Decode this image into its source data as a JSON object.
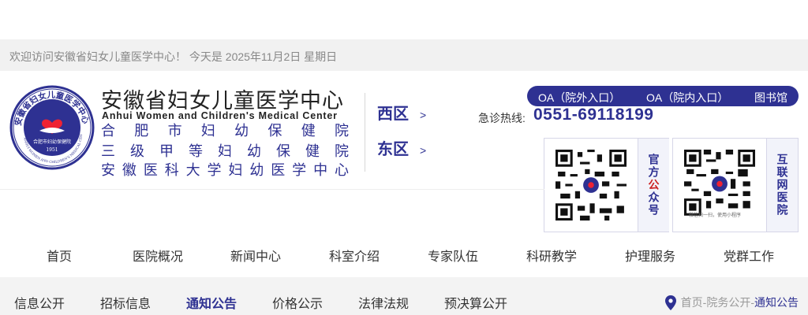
{
  "topbar": {
    "welcome": "欢迎访问安徽省妇女儿童医学中心！   今天是 2025年11月2日  星期日"
  },
  "brand": {
    "logo_ring_text": "安徽省妇女儿童医学中心",
    "logo_ring_text_en": "ANHUI WOMEN AND CHILDREN'S MEDICAL CENTER",
    "logo_inner": "合肥市妇幼保健院",
    "logo_year": "1951",
    "name_cn": "安徽省妇女儿童医学中心",
    "name_en": "Anhui Women and Children's Medical Center",
    "lines": [
      [
        "合",
        "肥",
        "市",
        "妇",
        "幼",
        "保",
        "健",
        "院"
      ],
      [
        "三",
        "级",
        "甲",
        "等",
        "妇",
        "幼",
        "保",
        "健",
        "院"
      ],
      [
        "安",
        "徽",
        "医",
        "科",
        "大",
        "学",
        "妇",
        "幼",
        "医",
        "学",
        "中",
        "心"
      ]
    ]
  },
  "districts": [
    {
      "label": "西区",
      "arrow": ">"
    },
    {
      "label": "东区",
      "arrow": ">"
    }
  ],
  "oa": {
    "outside": "OA（院外入口）",
    "inside": "OA（院内入口）",
    "library": "图书馆"
  },
  "hotline": {
    "label": "急诊热线:",
    "number": "0551-69118199"
  },
  "qrcodes": [
    {
      "cap1": "官方",
      "cap2": "公",
      "cap3": "众号"
    },
    {
      "cap": "互联网医院",
      "tiny": "微信扫一扫，使用小程序"
    }
  ],
  "nav": [
    "首页",
    "医院概况",
    "新闻中心",
    "科室介绍",
    "专家队伍",
    "科研教学",
    "护理服务",
    "党群工作"
  ],
  "subnav": [
    "信息公开",
    "招标信息",
    "通知公告",
    "价格公示",
    "法律法规",
    "预决算公开"
  ],
  "breadcrumb": {
    "home": "首页",
    "sep": " - ",
    "mid": "院务公开",
    "current": "通知公告"
  },
  "colors": {
    "brand": "#2e3192",
    "accent_red": "#c22222",
    "strip": "#f1f1f1"
  }
}
